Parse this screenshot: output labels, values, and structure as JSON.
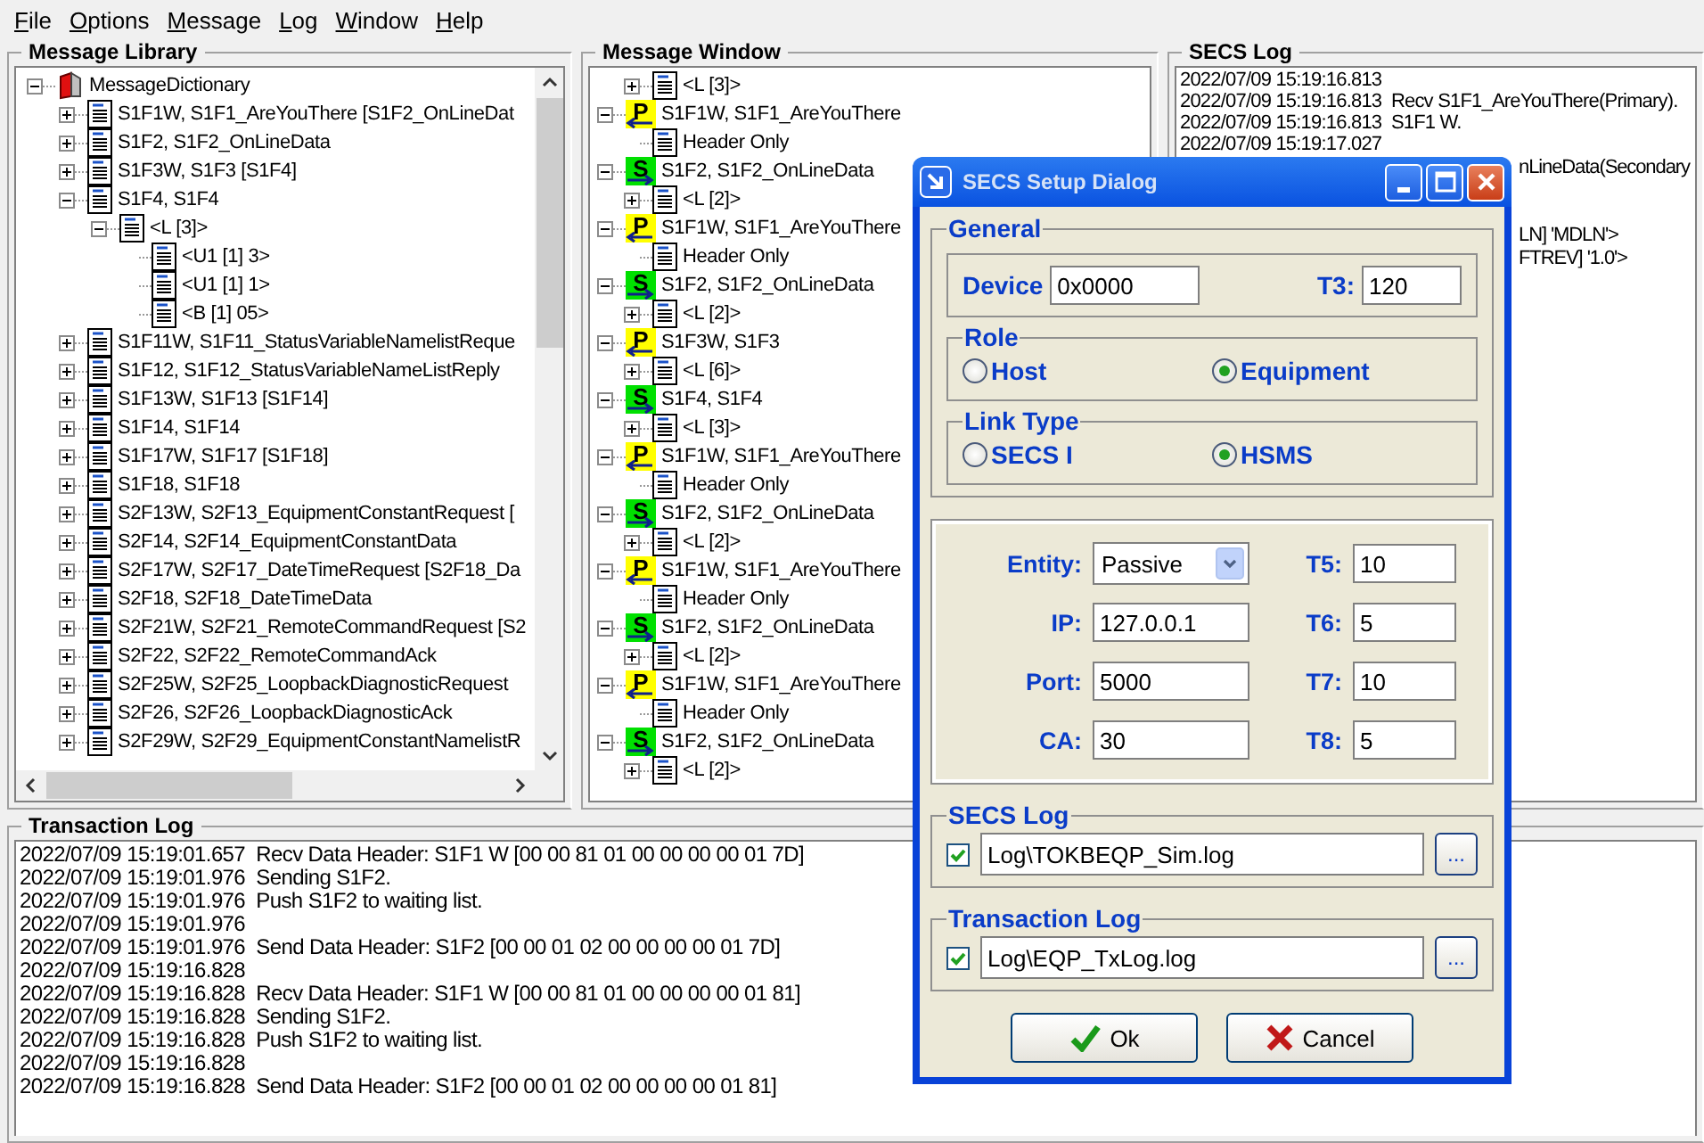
{
  "menu": [
    {
      "label": "File"
    },
    {
      "label": "Options"
    },
    {
      "label": "Message"
    },
    {
      "label": "Log"
    },
    {
      "label": "Window"
    },
    {
      "label": "Help"
    }
  ],
  "message_library": {
    "title": "Message Library",
    "tree": [
      {
        "kind": "root",
        "label": "MessageDictionary",
        "expanded": true,
        "children": [
          {
            "kind": "message",
            "label": "S1F1W, S1F1_AreYouThere [S1F2_OnLineDat",
            "expanded": false
          },
          {
            "kind": "message",
            "label": "S1F2, S1F2_OnLineData",
            "expanded": false
          },
          {
            "kind": "message",
            "label": "S1F3W, S1F3 [S1F4]",
            "expanded": false
          },
          {
            "kind": "message",
            "label": "S1F4, S1F4",
            "expanded": true,
            "children": [
              {
                "kind": "message",
                "label": "<L [3]>",
                "expanded": true,
                "children": [
                  {
                    "kind": "message",
                    "label": "<U1 [1] 3>"
                  },
                  {
                    "kind": "message",
                    "label": "<U1 [1] 1>"
                  },
                  {
                    "kind": "message",
                    "label": "<B [1] 05>"
                  }
                ]
              }
            ]
          },
          {
            "kind": "message",
            "label": "S1F11W, S1F11_StatusVariableNamelistReque",
            "expanded": false
          },
          {
            "kind": "message",
            "label": "S1F12, S1F12_StatusVariableNameListReply",
            "expanded": false
          },
          {
            "kind": "message",
            "label": "S1F13W, S1F13 [S1F14]",
            "expanded": false
          },
          {
            "kind": "message",
            "label": "S1F14, S1F14",
            "expanded": false
          },
          {
            "kind": "message",
            "label": "S1F17W, S1F17 [S1F18]",
            "expanded": false
          },
          {
            "kind": "message",
            "label": "S1F18, S1F18",
            "expanded": false
          },
          {
            "kind": "message",
            "label": "S2F13W, S2F13_EquipmentConstantRequest [",
            "expanded": false
          },
          {
            "kind": "message",
            "label": "S2F14, S2F14_EquipmentConstantData",
            "expanded": false
          },
          {
            "kind": "message",
            "label": "S2F17W, S2F17_DateTimeRequest [S2F18_Da",
            "expanded": false
          },
          {
            "kind": "message",
            "label": "S2F18, S2F18_DateTimeData",
            "expanded": false
          },
          {
            "kind": "message",
            "label": "S2F21W, S2F21_RemoteCommandRequest [S2",
            "expanded": false
          },
          {
            "kind": "message",
            "label": "S2F22, S2F22_RemoteCommandAck",
            "expanded": false
          },
          {
            "kind": "message",
            "label": "S2F25W, S2F25_LoopbackDiagnosticRequest",
            "expanded": false
          },
          {
            "kind": "message",
            "label": "S2F26, S2F26_LoopbackDiagnosticAck",
            "expanded": false
          },
          {
            "kind": "message",
            "label": "S2F29W, S2F29_EquipmentConstantNamelistR",
            "expanded": false
          }
        ]
      }
    ]
  },
  "message_window": {
    "title": "Message Window",
    "tree": [
      {
        "kind": "item",
        "label": "<L [3]>",
        "expanded": false
      },
      {
        "kind": "primary",
        "badge": "P",
        "label": "S1F1W, S1F1_AreYouThere",
        "expanded": true,
        "children": [
          {
            "kind": "item",
            "label": "Header Only"
          }
        ]
      },
      {
        "kind": "secondary",
        "badge": "S",
        "label": "S1F2, S1F2_OnLineData",
        "expanded": true,
        "children": [
          {
            "kind": "item",
            "label": "<L [2]>",
            "expanded": false
          }
        ]
      },
      {
        "kind": "primary",
        "badge": "P",
        "label": "S1F1W, S1F1_AreYouThere",
        "expanded": true,
        "children": [
          {
            "kind": "item",
            "label": "Header Only"
          }
        ]
      },
      {
        "kind": "secondary",
        "badge": "S",
        "label": "S1F2, S1F2_OnLineData",
        "expanded": true,
        "children": [
          {
            "kind": "item",
            "label": "<L [2]>",
            "expanded": false
          }
        ]
      },
      {
        "kind": "primary",
        "badge": "P",
        "label": "S1F3W, S1F3",
        "expanded": true,
        "children": [
          {
            "kind": "item",
            "label": "<L [6]>",
            "expanded": false
          }
        ]
      },
      {
        "kind": "secondary",
        "badge": "S",
        "label": "S1F4, S1F4",
        "expanded": true,
        "children": [
          {
            "kind": "item",
            "label": "<L [3]>",
            "expanded": false
          }
        ]
      },
      {
        "kind": "primary",
        "badge": "P",
        "label": "S1F1W, S1F1_AreYouThere",
        "expanded": true,
        "children": [
          {
            "kind": "item",
            "label": "Header Only"
          }
        ]
      },
      {
        "kind": "secondary",
        "badge": "S",
        "label": "S1F2, S1F2_OnLineData",
        "expanded": true,
        "children": [
          {
            "kind": "item",
            "label": "<L [2]>",
            "expanded": false
          }
        ]
      },
      {
        "kind": "primary",
        "badge": "P",
        "label": "S1F1W, S1F1_AreYouThere",
        "expanded": true,
        "children": [
          {
            "kind": "item",
            "label": "Header Only"
          }
        ]
      },
      {
        "kind": "secondary",
        "badge": "S",
        "label": "S1F2, S1F2_OnLineData",
        "expanded": true,
        "children": [
          {
            "kind": "item",
            "label": "<L [2]>",
            "expanded": false
          }
        ]
      },
      {
        "kind": "primary",
        "badge": "P",
        "label": "S1F1W, S1F1_AreYouThere",
        "expanded": true,
        "children": [
          {
            "kind": "item",
            "label": "Header Only"
          }
        ]
      },
      {
        "kind": "secondary",
        "badge": "S",
        "label": "S1F2, S1F2_OnLineData",
        "expanded": true,
        "children": [
          {
            "kind": "item",
            "label": "<L [2]>",
            "expanded": false
          }
        ]
      }
    ]
  },
  "secs_log": {
    "title": "SECS Log",
    "lines": [
      "2022/07/09 15:19:16.813",
      "2022/07/09 15:19:16.813  Recv S1F1_AreYouThere(Primary).",
      "2022/07/09 15:19:16.813  S1F1 W.",
      "2022/07/09 15:19:17.027"
    ],
    "tail_lines": [
      "nLineData(Secondary",
      "LN] 'MDLN'>",
      "FTREV] '1.0'>"
    ]
  },
  "transaction_log": {
    "title": "Transaction Log",
    "lines": [
      "2022/07/09 15:19:01.657  Recv Data Header: S1F1 W [00 00 81 01 00 00 00 00 01 7D]",
      "2022/07/09 15:19:01.976  Sending S1F2.",
      "2022/07/09 15:19:01.976  Push S1F2 to waiting list.",
      "2022/07/09 15:19:01.976",
      "2022/07/09 15:19:01.976  Send Data Header: S1F2 [00 00 01 02 00 00 00 00 01 7D]",
      "2022/07/09 15:19:16.828",
      "2022/07/09 15:19:16.828  Recv Data Header: S1F1 W [00 00 81 01 00 00 00 00 01 81]",
      "2022/07/09 15:19:16.828  Sending S1F2.",
      "2022/07/09 15:19:16.828  Push S1F2 to waiting list.",
      "2022/07/09 15:19:16.828",
      "2022/07/09 15:19:16.828  Send Data Header: S1F2 [00 00 01 02 00 00 00 00 01 81]"
    ]
  },
  "dialog": {
    "title": "SECS Setup Dialog",
    "general": {
      "title": "General",
      "device_label": "Device",
      "device": "0x0000",
      "t3_label": "T3:",
      "t3": "120"
    },
    "role": {
      "title": "Role",
      "options": [
        {
          "label": "Host",
          "selected": false
        },
        {
          "label": "Equipment",
          "selected": true
        }
      ]
    },
    "link_type": {
      "title": "Link Type",
      "options": [
        {
          "label": "SECS I",
          "selected": false
        },
        {
          "label": "HSMS",
          "selected": true
        }
      ]
    },
    "hsms": {
      "fields": [
        {
          "kind": "dropdown",
          "label": "Entity:",
          "value": "Passive"
        },
        {
          "kind": "text",
          "label": "IP:",
          "value": "127.0.0.1"
        },
        {
          "kind": "text",
          "label": "Port:",
          "value": "5000"
        },
        {
          "kind": "text",
          "label": "CA:",
          "value": "30"
        }
      ],
      "timers": [
        {
          "label": "T5:",
          "value": "10"
        },
        {
          "label": "T6:",
          "value": "5"
        },
        {
          "label": "T7:",
          "value": "10"
        },
        {
          "label": "T8:",
          "value": "5"
        }
      ]
    },
    "logs": [
      {
        "title": "SECS Log",
        "checked": true,
        "path": "Log\\TOKBEQP_Sim.log",
        "browse": "..."
      },
      {
        "title": "Transaction Log",
        "checked": true,
        "path": "Log\\EQP_TxLog.log",
        "browse": "..."
      }
    ],
    "buttons": [
      {
        "kind": "ok",
        "label": "Ok"
      },
      {
        "kind": "cancel",
        "label": "Cancel"
      }
    ]
  }
}
